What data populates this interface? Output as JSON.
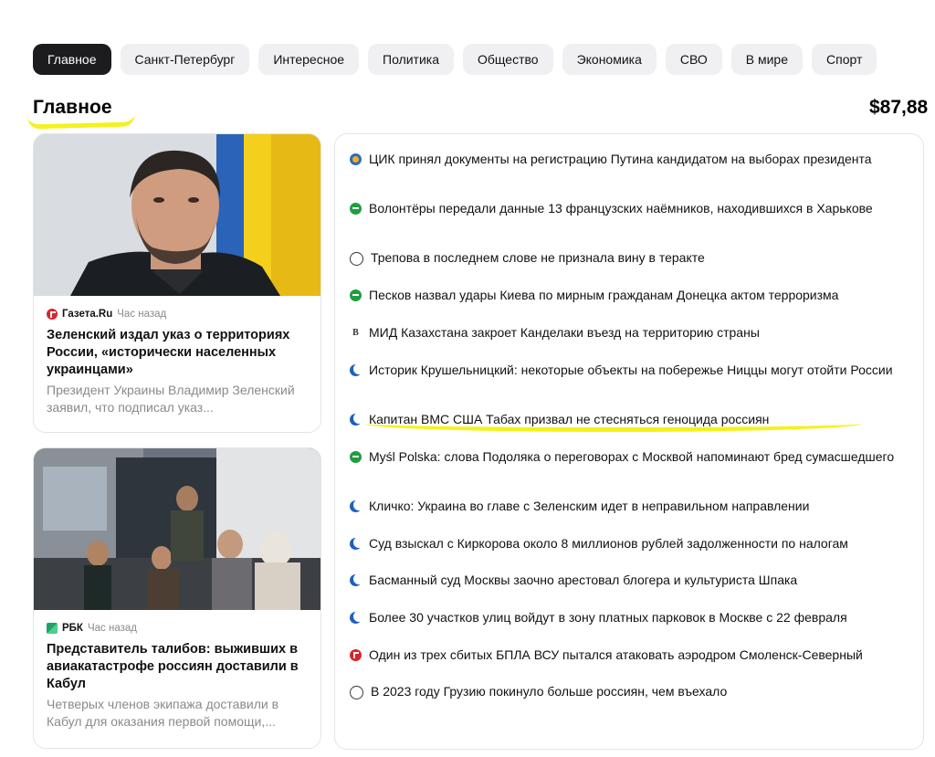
{
  "tabs": [
    "Главное",
    "Санкт-Петербург",
    "Интересное",
    "Политика",
    "Общество",
    "Экономика",
    "СВО",
    "В мире",
    "Спорт"
  ],
  "page_title": "Главное",
  "currency": "$87,88",
  "cards": [
    {
      "source": "Газета.Ru",
      "time": "Час назад",
      "headline": "Зеленский издал указ о территориях России, «исторически населенных украинцами»",
      "snippet": "Президент Украины Владимир Зеленский заявил, что подписал указ..."
    },
    {
      "source": "РБК",
      "time": "Час назад",
      "headline": "Представитель талибов: выживших в авиакатастрофе россиян доставили в Кабул",
      "snippet": "Четверых членов экипажа доставили в Кабул для оказания первой помощи,..."
    }
  ],
  "news": [
    {
      "icon": "argumenty-icon",
      "text": "ЦИК принял документы на регистрацию Путина кандидатом на выборах президента"
    },
    {
      "icon": "green-source-icon",
      "text": "Волонтёры передали данные 13 французских наёмников, находившихся в Харькове"
    },
    {
      "icon": "circle-letter-icon",
      "text": "Трепова в последнем слове не признала вину в теракте"
    },
    {
      "icon": "green-source-icon",
      "text": "Песков назвал удары Киева по мирным гражданам Донецка актом терроризма"
    },
    {
      "icon": "vedomosti-icon",
      "text": "МИД Казахстана закроет Канделаки въезд на территорию страны"
    },
    {
      "icon": "moon-icon",
      "text": "Историк Крушельницкий: некоторые объекты на побережье Ниццы могут отойти России"
    },
    {
      "icon": "moon-icon",
      "text": "Капитан ВМС США Табах призвал не стесняться геноцида россиян"
    },
    {
      "icon": "green-source-icon",
      "text": "Myśl Polska: слова Подоляка о переговорах с Москвой напоминают бред сумасшедшего"
    },
    {
      "icon": "moon-icon",
      "text": "Кличко: Украина во главе с Зеленским идет в неправильном направлении"
    },
    {
      "icon": "moon-icon",
      "text": "Суд взыскал с Киркорова около 8 миллионов рублей задолженности по налогам"
    },
    {
      "icon": "moon-icon",
      "text": "Басманный суд Москвы заочно арестовал блогера и культуриста Шпака"
    },
    {
      "icon": "moon-icon",
      "text": "Более 30 участков улиц войдут в зону платных парковок в Москве с 22 февраля"
    },
    {
      "icon": "gazeta-icon",
      "text": "Один из трех сбитых БПЛА ВСУ пытался атаковать аэродром Смоленск-Северный"
    },
    {
      "icon": "circle-letter-icon",
      "text": "В 2023 году Грузию покинуло больше россиян, чем въехало"
    }
  ]
}
